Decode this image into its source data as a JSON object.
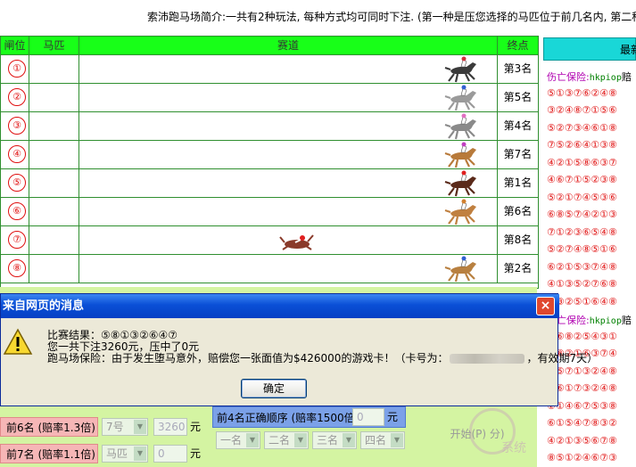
{
  "intro_text": "索沛跑马场简介:一共有2种玩法, 每种方式均可同时下注. (第一种是压您选择的马匹位于前几名内, 第二种",
  "track": {
    "headers": {
      "gate": "闸位",
      "horse": "马匹",
      "track": "赛道",
      "finish": "终点"
    },
    "rows": [
      {
        "gate": "①",
        "finish": "第3名",
        "horse_color": "#3a3a3a",
        "cap": "#d0303a",
        "fallen": false,
        "pos": 0.96
      },
      {
        "gate": "②",
        "finish": "第5名",
        "horse_color": "#9a9a9a",
        "cap": "#3060d0",
        "fallen": false,
        "pos": 0.96
      },
      {
        "gate": "③",
        "finish": "第4名",
        "horse_color": "#8a8a8a",
        "cap": "#e070c0",
        "fallen": false,
        "pos": 0.96
      },
      {
        "gate": "④",
        "finish": "第7名",
        "horse_color": "#b87a3a",
        "cap": "#c040c0",
        "fallen": false,
        "pos": 0.96
      },
      {
        "gate": "⑤",
        "finish": "第1名",
        "horse_color": "#5a2a1a",
        "cap": "#e02020",
        "fallen": false,
        "pos": 0.96
      },
      {
        "gate": "⑥",
        "finish": "第6名",
        "horse_color": "#c08040",
        "cap": "#d08030",
        "fallen": false,
        "pos": 0.96
      },
      {
        "gate": "⑦",
        "finish": "第8名",
        "horse_color": "#8a3a2a",
        "cap": "#e02020",
        "fallen": true,
        "pos": 0.52
      },
      {
        "gate": "⑧",
        "finish": "第2名",
        "horse_color": "#b88040",
        "cap": "#3060d0",
        "fallen": false,
        "pos": 0.96
      }
    ]
  },
  "right_panel": {
    "title": "最新",
    "feed": [
      {
        "kind": "title",
        "label": "伤亡保险:",
        "link": "hkpiop",
        "tail": "赔"
      },
      {
        "kind": "seq",
        "text": "⑤①③⑦⑥②④⑧"
      },
      {
        "kind": "seq",
        "text": "③②④⑧⑦①⑤⑥"
      },
      {
        "kind": "seq",
        "text": "⑤②⑦③④⑥①⑧"
      },
      {
        "kind": "seq",
        "text": "⑦⑤②⑥④①③⑧"
      },
      {
        "kind": "seq",
        "text": "④②①⑤⑧⑥③⑦"
      },
      {
        "kind": "seq",
        "text": "④⑥⑦①⑤②③⑧"
      },
      {
        "kind": "seq",
        "text": "⑤②①⑦④⑤③⑥"
      },
      {
        "kind": "seq",
        "text": "⑥⑧⑤⑦④②①③"
      },
      {
        "kind": "seq",
        "text": "⑦①②③⑥⑤④⑧"
      },
      {
        "kind": "seq",
        "text": "⑤②⑦④⑧⑤①⑥"
      },
      {
        "kind": "seq",
        "text": "⑥②①⑤③⑦④⑧"
      },
      {
        "kind": "seq",
        "text": "④①③⑤②⑦⑥⑧"
      },
      {
        "kind": "seq",
        "text": "⑦③②⑤①⑥④⑧"
      },
      {
        "kind": "title",
        "label": "伤亡保险:",
        "link": "hkpiop",
        "tail": "赔"
      },
      {
        "kind": "seq",
        "text": "③⑥⑧②⑤④③①"
      },
      {
        "kind": "seq",
        "text": "⑤⑧②①⑥③⑦④"
      },
      {
        "kind": "seq",
        "text": "⑥⑤⑦①③②④⑧"
      },
      {
        "kind": "seq",
        "text": "⑤⑥①⑦③②④⑧"
      },
      {
        "kind": "seq",
        "text": "②①④⑥⑦⑤③⑧"
      },
      {
        "kind": "seq",
        "text": "⑥①⑤④⑦⑧③②"
      },
      {
        "kind": "seq",
        "text": "④②①③⑤⑥⑦⑧"
      },
      {
        "kind": "seq",
        "text": "⑧⑤①②④⑥⑦③"
      }
    ]
  },
  "bottom": {
    "bets": [
      {
        "label": "前6名 (赔率1.3倍)",
        "horse": "7号",
        "amount": "3260",
        "unit": "元"
      },
      {
        "label": "前7名 (赔率1.1倍)",
        "horse": "马匹",
        "amount": "0",
        "unit": "元"
      }
    ],
    "order": {
      "label": "前4名正确顺序 (赔率1500倍)",
      "amount": "0",
      "unit": "元"
    },
    "rank_selects": [
      "一名",
      "二名",
      "三名",
      "四名"
    ],
    "start_label": "开始(P) 分)",
    "watermark": "系统"
  },
  "dialog": {
    "title": "来自网页的消息",
    "close": "×",
    "line1": "比赛结果：⑤⑧①③②⑥④⑦",
    "line2": "您一共下注3260元，压中了0元",
    "line3_prefix": "跑马场保险：由于发生堕马意外，赔偿您一张面值为$426000的游戏卡！（卡号为：",
    "line3_suffix": "，有效期7天）",
    "ok": "确定"
  },
  "colors": {
    "header_green": "#18ff18",
    "grid_green": "#2f8f2f",
    "form_bg": "#d4f4a2",
    "bet_pink": "#f6b6b6",
    "order_blue": "#7ba1e8",
    "gate_red": "#e01010",
    "panel_cyan": "#19d7d7",
    "xp_title": "#0a4fd6"
  }
}
